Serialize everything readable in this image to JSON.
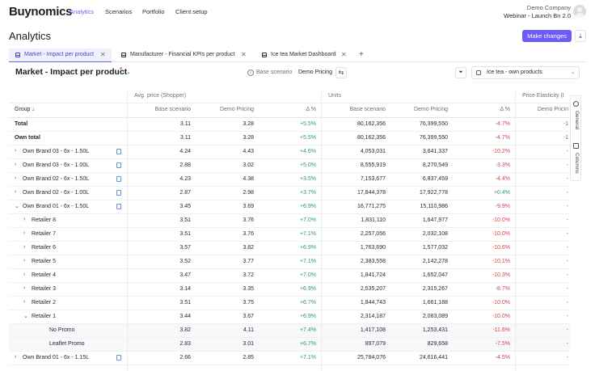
{
  "nav": {
    "logo": "Buynomics",
    "links": [
      {
        "label": "Analytics",
        "active": true
      },
      {
        "label": "Scenarios",
        "active": false
      },
      {
        "label": "Portfolio",
        "active": false
      },
      {
        "label": "Client setup",
        "active": false
      }
    ],
    "company": "Demo Company",
    "project": "Webinar - Launch Bn 2.0"
  },
  "page": {
    "title": "Analytics",
    "make_changes": "Make changes",
    "accent": "#6b5cf6"
  },
  "tabs": [
    {
      "label": "Market - Impact per product",
      "active": true
    },
    {
      "label": "Manufacturer - Financial KPIs per product",
      "active": false
    },
    {
      "label": "Ice tea Market Dashboard",
      "active": false
    }
  ],
  "view": {
    "title": "Market - Impact per product",
    "base_label": "Base scenario",
    "compare_label": "Demo Pricing",
    "segment": "Ice tea - own products"
  },
  "table": {
    "group_headers": [
      "Avg. price (Shopper)",
      "Units",
      "Price Elasticity (I"
    ],
    "columns": [
      "Group",
      "Base scenario",
      "Demo Pricing",
      "Δ %",
      "Base scenario",
      "Demo Pricing",
      "Δ %",
      "Demo Pricin"
    ],
    "rows": [
      {
        "name": "Total",
        "level": 0,
        "bold": true,
        "chev": "",
        "icon": false,
        "v": [
          "3.11",
          "3.28",
          "+5.5%",
          "80,162,356",
          "76,399,550",
          "-4.7%",
          "-1"
        ]
      },
      {
        "name": "Own total",
        "level": 0,
        "bold": true,
        "chev": "",
        "icon": false,
        "v": [
          "3.11",
          "3.28",
          "+5.5%",
          "80,162,356",
          "76,399,550",
          "-4.7%",
          "-1"
        ]
      },
      {
        "name": "Own Brand 03 - 6x - 1.50L",
        "level": 0,
        "bold": false,
        "chev": "›",
        "icon": true,
        "v": [
          "4.24",
          "4.43",
          "+4.6%",
          "4,053,031",
          "3,641,337",
          "-10.2%",
          "-"
        ]
      },
      {
        "name": "Own Brand 03 - 6x - 1.00L",
        "level": 0,
        "bold": false,
        "chev": "›",
        "icon": true,
        "v": [
          "2.88",
          "3.02",
          "+5.0%",
          "8,555,919",
          "8,270,549",
          "-3.3%",
          "-"
        ]
      },
      {
        "name": "Own Brand 02 - 6x - 1.50L",
        "level": 0,
        "bold": false,
        "chev": "›",
        "icon": true,
        "v": [
          "4.23",
          "4.38",
          "+3.5%",
          "7,153,677",
          "6,837,459",
          "-4.4%",
          "-"
        ]
      },
      {
        "name": "Own Brand 02 - 6x - 1.00L",
        "level": 0,
        "bold": false,
        "chev": "›",
        "icon": true,
        "v": [
          "2.87",
          "2.98",
          "+3.7%",
          "17,844,378",
          "17,922,778",
          "+0.4%",
          "-"
        ]
      },
      {
        "name": "Own Brand 01 - 6x - 1.50L",
        "level": 0,
        "bold": false,
        "chev": "⌄",
        "icon": true,
        "v": [
          "3.45",
          "3.69",
          "+6.9%",
          "16,771,275",
          "15,110,986",
          "-9.9%",
          "-"
        ]
      },
      {
        "name": "Retailer 8",
        "level": 1,
        "bold": false,
        "chev": "›",
        "icon": false,
        "v": [
          "3.51",
          "3.76",
          "+7.0%",
          "1,831,110",
          "1,647,977",
          "-10.0%",
          "-"
        ]
      },
      {
        "name": "Retailer 7",
        "level": 1,
        "bold": false,
        "chev": "›",
        "icon": false,
        "v": [
          "3.51",
          "3.76",
          "+7.1%",
          "2,257,056",
          "2,032,108",
          "-10.0%",
          "-"
        ]
      },
      {
        "name": "Retailer 6",
        "level": 1,
        "bold": false,
        "chev": "›",
        "icon": false,
        "v": [
          "3.57",
          "3.82",
          "+6.9%",
          "1,763,690",
          "1,577,032",
          "-10.6%",
          "-"
        ]
      },
      {
        "name": "Retailer 5",
        "level": 1,
        "bold": false,
        "chev": "›",
        "icon": false,
        "v": [
          "3.52",
          "3.77",
          "+7.1%",
          "2,383,558",
          "2,142,278",
          "-10.1%",
          "-"
        ]
      },
      {
        "name": "Retailer 4",
        "level": 1,
        "bold": false,
        "chev": "›",
        "icon": false,
        "v": [
          "3.47",
          "3.72",
          "+7.0%",
          "1,841,724",
          "1,652,047",
          "-10.3%",
          "-"
        ]
      },
      {
        "name": "Retailer 3",
        "level": 1,
        "bold": false,
        "chev": "›",
        "icon": false,
        "v": [
          "3.14",
          "3.35",
          "+6.9%",
          "2,535,207",
          "2,315,267",
          "-8.7%",
          "-"
        ]
      },
      {
        "name": "Retailer 2",
        "level": 1,
        "bold": false,
        "chev": "›",
        "icon": false,
        "v": [
          "3.51",
          "3.75",
          "+6.7%",
          "1,844,743",
          "1,661,188",
          "-10.0%",
          "-"
        ]
      },
      {
        "name": "Retailer 1",
        "level": 1,
        "bold": false,
        "chev": "⌄",
        "icon": false,
        "v": [
          "3.44",
          "3.67",
          "+6.9%",
          "2,314,187",
          "2,083,089",
          "-10.0%",
          "-"
        ]
      },
      {
        "name": "No Promo",
        "level": 2,
        "bold": false,
        "chev": "",
        "icon": false,
        "shaded": true,
        "v": [
          "3.82",
          "4.11",
          "+7.4%",
          "1,417,108",
          "1,253,431",
          "-11.6%",
          "-"
        ]
      },
      {
        "name": "Leaflet Promo",
        "level": 2,
        "bold": false,
        "chev": "",
        "icon": false,
        "shaded": true,
        "v": [
          "2.83",
          "3.01",
          "+6.7%",
          "897,079",
          "829,658",
          "-7.5%",
          "-"
        ]
      },
      {
        "name": "Own Brand 01 - 6x - 1.15L",
        "level": 0,
        "bold": false,
        "chev": "›",
        "icon": true,
        "v": [
          "2.66",
          "2.85",
          "+7.1%",
          "25,784,076",
          "24,616,441",
          "-4.5%",
          "-"
        ]
      }
    ]
  },
  "side_panel": [
    "General",
    "Columns"
  ],
  "colors": {
    "positive": "#2e9e57",
    "negative": "#d64545"
  }
}
